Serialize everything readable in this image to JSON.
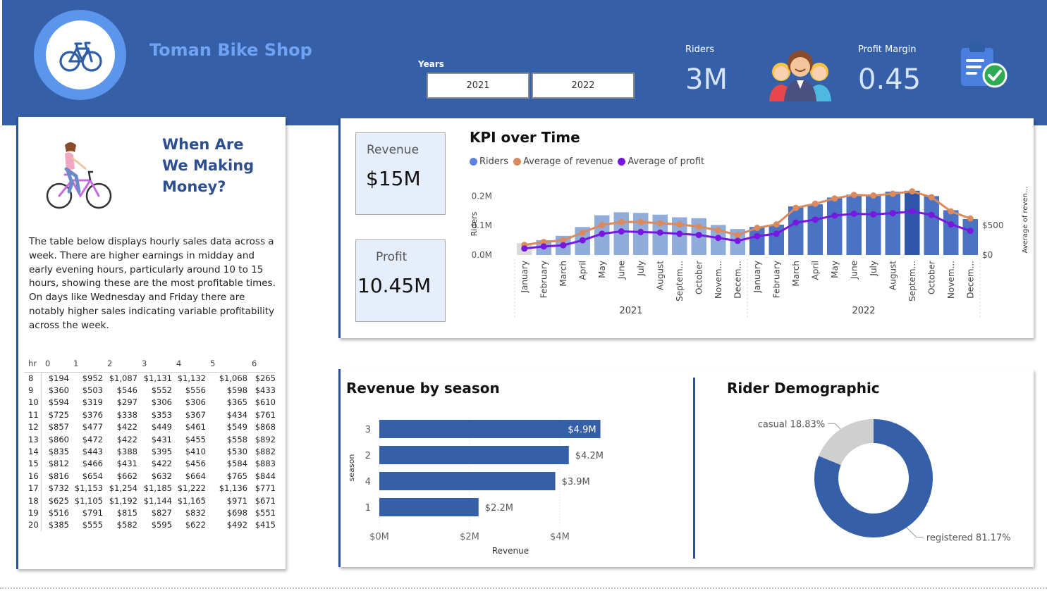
{
  "header": {
    "brand": "Toman Bike Shop",
    "years_label": "Years",
    "years": [
      "2021",
      "2022"
    ],
    "riders_label": "Riders",
    "riders_value": "3M",
    "profit_margin_label": "Profit Margin",
    "profit_margin_value": "0.45",
    "icons": [
      "bicycle-icon",
      "people-group-icon",
      "clipboard-check-icon"
    ]
  },
  "money": {
    "title_lines": [
      "When Are",
      "We Making",
      "Money?"
    ],
    "description": "The table below displays hourly sales data across a week. There are higher earnings in midday and early evening hours, particularly around 10 to 15 hours, showing these are the most profitable times. On days like Wednesday and Friday there are notably higher sales indicating variable profitability across the week.",
    "table": {
      "columns": [
        "hr",
        "0",
        "1",
        "2",
        "3",
        "4",
        "5",
        "6"
      ],
      "rows": [
        [
          "8",
          "$194",
          "$952",
          "$1,087",
          "$1,131",
          "$1,132",
          "$1,068",
          "$265"
        ],
        [
          "9",
          "$360",
          "$503",
          "$546",
          "$552",
          "$556",
          "$598",
          "$433"
        ],
        [
          "10",
          "$594",
          "$319",
          "$297",
          "$306",
          "$306",
          "$365",
          "$610"
        ],
        [
          "11",
          "$725",
          "$376",
          "$338",
          "$353",
          "$367",
          "$434",
          "$761"
        ],
        [
          "12",
          "$857",
          "$477",
          "$422",
          "$449",
          "$461",
          "$549",
          "$868"
        ],
        [
          "13",
          "$860",
          "$472",
          "$422",
          "$431",
          "$455",
          "$558",
          "$892"
        ],
        [
          "14",
          "$835",
          "$443",
          "$388",
          "$395",
          "$410",
          "$530",
          "$882"
        ],
        [
          "15",
          "$812",
          "$466",
          "$431",
          "$422",
          "$456",
          "$584",
          "$883"
        ],
        [
          "16",
          "$816",
          "$654",
          "$662",
          "$632",
          "$664",
          "$765",
          "$844"
        ],
        [
          "17",
          "$732",
          "$1,153",
          "$1,254",
          "$1,185",
          "$1,222",
          "$1,136",
          "$771"
        ],
        [
          "18",
          "$625",
          "$1,105",
          "$1,192",
          "$1,144",
          "$1,165",
          "$971",
          "$671"
        ],
        [
          "19",
          "$516",
          "$791",
          "$815",
          "$827",
          "$832",
          "$698",
          "$551"
        ],
        [
          "20",
          "$385",
          "$555",
          "$582",
          "$595",
          "$622",
          "$492",
          "$415"
        ]
      ]
    }
  },
  "kpis": {
    "revenue_label": "Revenue",
    "revenue_value": "$15M",
    "profit_label": "Profit",
    "profit_value": "10.45M"
  },
  "colors": {
    "header_bg": "#3560A8",
    "riders_bar_2021": "#90ACDB",
    "riders_bar_2022": "#4A73C3",
    "riders_bar_highlight": "#2E56AA",
    "revenue_line": "#D98A5E",
    "profit_line": "#7718E0",
    "season_bar": "#3560A8",
    "donut_registered": "#3560A8",
    "donut_casual": "#CFCFCF"
  },
  "chart_data": [
    {
      "type": "bar",
      "title": "KPI over Time",
      "legend": [
        "Riders",
        "Average of revenue",
        "Average of profit"
      ],
      "legend_position": "top-left",
      "ylabel": "Riders",
      "y2label": "Average of reven...",
      "x_groups": [
        "2021",
        "2022"
      ],
      "categories": [
        "January",
        "February",
        "March",
        "April",
        "May",
        "June",
        "July",
        "August",
        "Septem...",
        "October",
        "Novem...",
        "Decem...",
        "January",
        "February",
        "March",
        "April",
        "May",
        "June",
        "July",
        "August",
        "Septem...",
        "October",
        "Novem...",
        "Decem..."
      ],
      "y_ticks": [
        "0.0M",
        "0.1M",
        "0.2M"
      ],
      "ylim": [
        0,
        0.22
      ],
      "y2_ticks": [
        "$0",
        "$500"
      ],
      "y2lim": [
        0,
        1100
      ],
      "series": [
        {
          "name": "Riders",
          "kind": "bar",
          "values": [
            0.04,
            0.05,
            0.065,
            0.095,
            0.135,
            0.145,
            0.143,
            0.137,
            0.128,
            0.125,
            0.102,
            0.088,
            0.095,
            0.103,
            0.165,
            0.172,
            0.195,
            0.205,
            0.205,
            0.215,
            0.218,
            0.2,
            0.152,
            0.122
          ]
        },
        {
          "name": "Average of revenue",
          "kind": "line",
          "values": [
            170,
            220,
            250,
            380,
            510,
            560,
            560,
            540,
            520,
            480,
            420,
            340,
            460,
            520,
            800,
            870,
            960,
            1020,
            1010,
            1040,
            1080,
            980,
            740,
            620
          ]
        },
        {
          "name": "Average of profit",
          "kind": "line",
          "values": [
            110,
            145,
            165,
            250,
            360,
            400,
            390,
            380,
            360,
            340,
            290,
            240,
            320,
            360,
            550,
            600,
            670,
            700,
            690,
            710,
            740,
            680,
            520,
            410
          ]
        }
      ]
    },
    {
      "type": "bar",
      "orientation": "horizontal",
      "title": "Revenue by season",
      "ylabel": "season",
      "xlabel": "Revenue",
      "categories": [
        "3",
        "2",
        "4",
        "1"
      ],
      "values": [
        4.9,
        4.2,
        3.9,
        2.2
      ],
      "value_labels": [
        "$4.9M",
        "$4.2M",
        "$3.9M",
        "$2.2M"
      ],
      "x_ticks": [
        "$0M",
        "$2M",
        "$4M"
      ],
      "xlim": [
        0,
        5
      ]
    },
    {
      "type": "pie",
      "donut": true,
      "title": "Rider Demographic",
      "slices": [
        {
          "label": "registered",
          "value": 81.17,
          "text": "registered 81.17%"
        },
        {
          "label": "casual",
          "value": 18.83,
          "text": "casual 18.83%"
        }
      ]
    }
  ]
}
